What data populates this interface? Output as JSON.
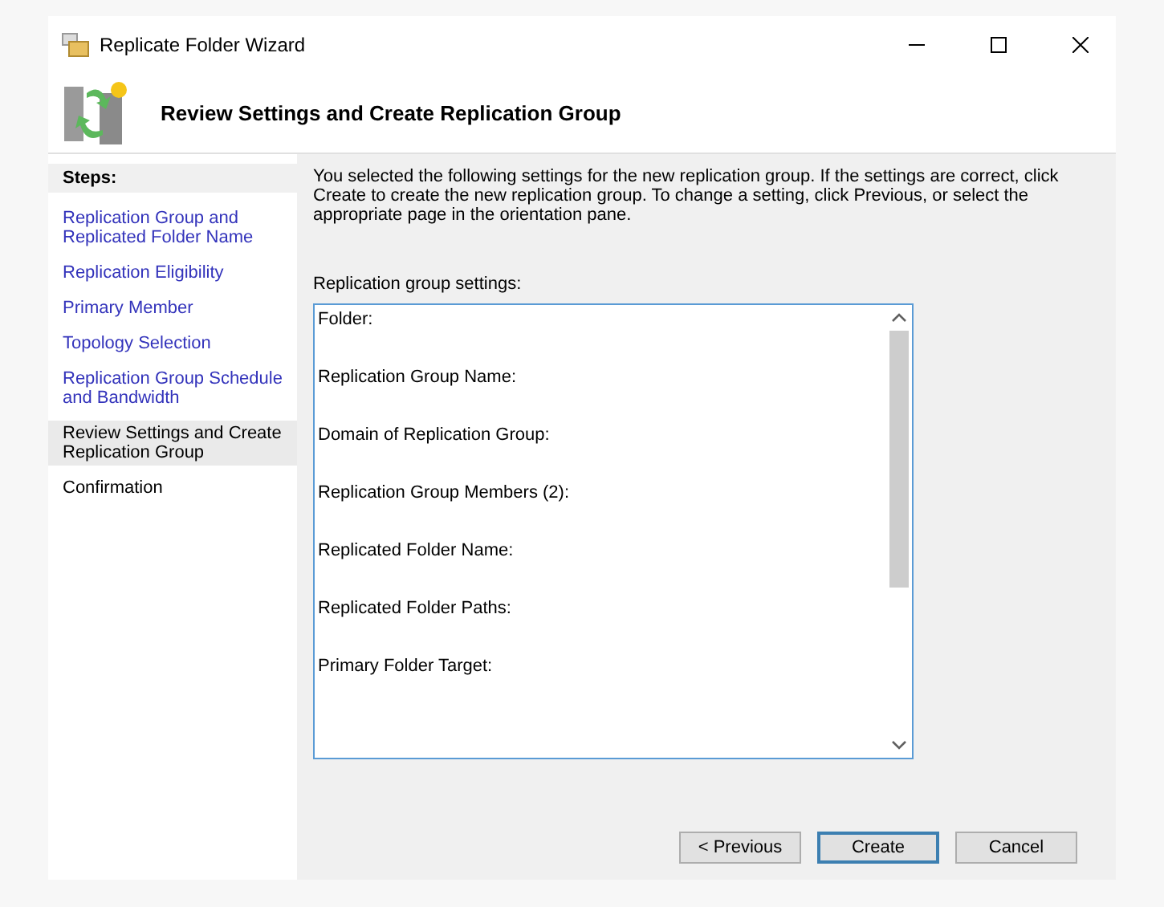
{
  "window": {
    "title": "Replicate Folder Wizard"
  },
  "header": {
    "title": "Review Settings and Create Replication Group"
  },
  "steps": {
    "heading": "Steps:",
    "items": [
      {
        "label": "Replication Group and Replicated Folder Name",
        "selected": false,
        "link": true
      },
      {
        "label": "Replication Eligibility",
        "selected": false,
        "link": true
      },
      {
        "label": "Primary Member",
        "selected": false,
        "link": true
      },
      {
        "label": "Topology Selection",
        "selected": false,
        "link": true
      },
      {
        "label": "Replication Group Schedule and Bandwidth",
        "selected": false,
        "link": true
      },
      {
        "label": "Review Settings and Create Replication Group",
        "selected": true,
        "link": false
      },
      {
        "label": "Confirmation",
        "selected": false,
        "link": false
      }
    ]
  },
  "intro": "You selected the following settings for the new replication group. If the settings are correct, click Create to create the new replication group. To change a setting, click Previous, or select the appropriate page in the orientation pane.",
  "settings": {
    "label": "Replication group settings:",
    "lines": [
      "Folder:",
      "Replication Group Name:",
      "Domain of Replication Group:",
      "Replication Group Members (2):",
      "Replicated Folder Name:",
      "Replicated Folder Paths:",
      "Primary Folder Target:"
    ]
  },
  "buttons": [
    {
      "label": "< Previous",
      "default": false
    },
    {
      "label": "Create",
      "default": true
    },
    {
      "label": "Cancel",
      "default": false
    }
  ]
}
